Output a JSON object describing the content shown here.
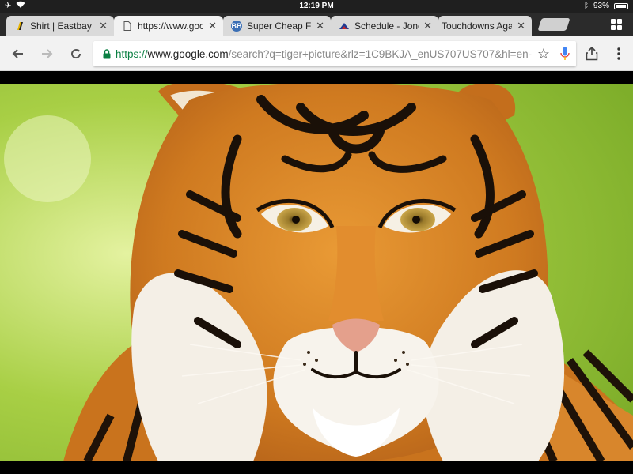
{
  "status_bar": {
    "time": "12:19 PM",
    "battery": "93%"
  },
  "tabs": [
    {
      "title": "Shirt | Eastbay Te",
      "favicon": "eastbay-logo-icon"
    },
    {
      "title": "https://www.goog",
      "favicon": "page-icon"
    },
    {
      "title": "Super Cheap Fligh",
      "favicon": "bb-logo-icon",
      "favicon_text": "BB"
    },
    {
      "title": "Schedule - Jones",
      "favicon": "sports-logo-icon"
    },
    {
      "title": "Touchdowns Agai",
      "favicon": "none"
    }
  ],
  "toolbar": {
    "url_scheme": "https://",
    "url_host": "www.google.com",
    "url_path": "/search?q=tiger+picture&rlz=1C9BKJA_enUS707US707&hl=en-US&prmd=ivns&tbm=isch"
  },
  "colors": {
    "secure_green": "#0b8043",
    "mic_blue": "#4285f4"
  },
  "main": {
    "image_subject": "tiger-face-photo"
  }
}
